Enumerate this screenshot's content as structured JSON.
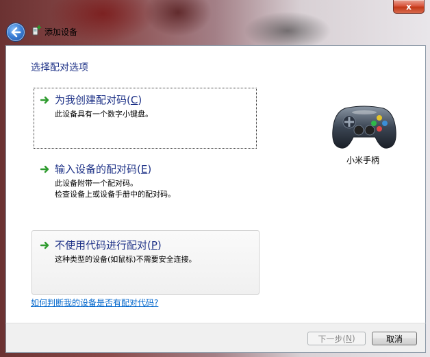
{
  "window": {
    "title": "添加设备",
    "close_label": "x"
  },
  "page": {
    "heading": "选择配对选项",
    "options": [
      {
        "title": "为我创建配对码(",
        "accel": "C",
        "title_end": ")",
        "desc_lines": [
          "此设备具有一个数字小键盘。"
        ]
      },
      {
        "title": "输入设备的配对码(",
        "accel": "E",
        "title_end": ")",
        "desc_lines": [
          "此设备附带一个配对码。",
          "检查设备上或设备手册中的配对码。"
        ]
      },
      {
        "title": "不使用代码进行配对(",
        "accel": "P",
        "title_end": ")",
        "desc_lines": [
          "这种类型的设备(如鼠标)不需要安全连接。"
        ]
      }
    ],
    "device": {
      "name": "小米手柄",
      "icon": "gamepad-icon"
    },
    "help_link": "如何判断我的设备是否有配对代码?"
  },
  "footer": {
    "next_label": "下一步(",
    "next_accel": "N",
    "next_end": ")",
    "cancel_label": "取消"
  },
  "colors": {
    "heading": "#1e3287",
    "link": "#0066cc",
    "arrow_green": "#2e9b2e"
  }
}
